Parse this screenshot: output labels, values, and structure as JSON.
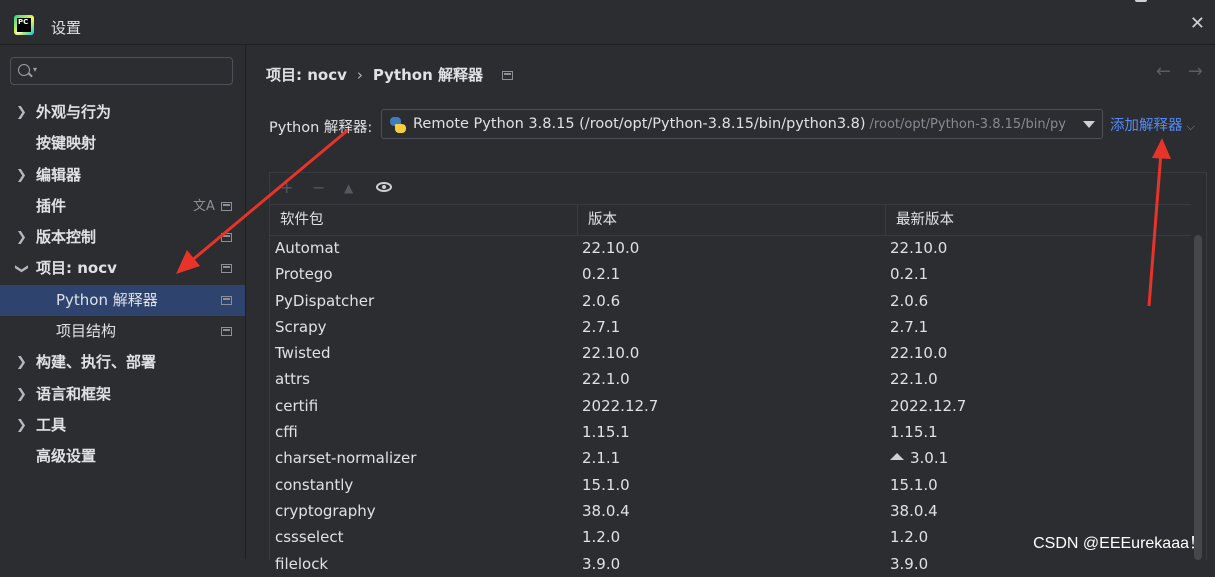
{
  "window": {
    "title": "设置",
    "app_icon_text": "PC"
  },
  "sidebar": {
    "search": {
      "value": "",
      "placeholder": ""
    },
    "items": [
      {
        "label": "外观与行为",
        "chevron": "›"
      },
      {
        "label": "按键映射",
        "chevron": ""
      },
      {
        "label": "编辑器",
        "chevron": "›"
      },
      {
        "label": "插件",
        "chevron": ""
      },
      {
        "label": "版本控制",
        "chevron": "›"
      },
      {
        "label": "项目: nocv",
        "chevron": "⌄"
      },
      {
        "label": "Python 解释器",
        "chevron": ""
      },
      {
        "label": "项目结构",
        "chevron": ""
      },
      {
        "label": "构建、执行、部署",
        "chevron": "›"
      },
      {
        "label": "语言和框架",
        "chevron": "›"
      },
      {
        "label": "工具",
        "chevron": "›"
      },
      {
        "label": "高级设置",
        "chevron": ""
      }
    ]
  },
  "main": {
    "breadcrumb": {
      "project": "项目: nocv",
      "separator": "›",
      "page": "Python 解释器"
    },
    "interpreter_label": "Python 解释器:",
    "interpreter_value": "Remote Python 3.8.15 (/root/opt/Python-3.8.15/bin/python3.8)",
    "interpreter_path": "/root/opt/Python-3.8.15/bin/py",
    "add_interpreter": "添加解释器",
    "toolbar": {
      "add": "+",
      "remove": "−",
      "upgrade": "▲"
    },
    "table": {
      "headers": [
        "软件包",
        "版本",
        "最新版本"
      ],
      "rows": [
        {
          "name": "Automat",
          "version": "22.10.0",
          "latest": "22.10.0",
          "upgrade": false
        },
        {
          "name": "Protego",
          "version": "0.2.1",
          "latest": "0.2.1",
          "upgrade": false
        },
        {
          "name": "PyDispatcher",
          "version": "2.0.6",
          "latest": "2.0.6",
          "upgrade": false
        },
        {
          "name": "Scrapy",
          "version": "2.7.1",
          "latest": "2.7.1",
          "upgrade": false
        },
        {
          "name": "Twisted",
          "version": "22.10.0",
          "latest": "22.10.0",
          "upgrade": false
        },
        {
          "name": "attrs",
          "version": "22.1.0",
          "latest": "22.1.0",
          "upgrade": false
        },
        {
          "name": "certifi",
          "version": "2022.12.7",
          "latest": "2022.12.7",
          "upgrade": false
        },
        {
          "name": "cffi",
          "version": "1.15.1",
          "latest": "1.15.1",
          "upgrade": false
        },
        {
          "name": "charset-normalizer",
          "version": "2.1.1",
          "latest": "3.0.1",
          "upgrade": true
        },
        {
          "name": "constantly",
          "version": "15.1.0",
          "latest": "15.1.0",
          "upgrade": false
        },
        {
          "name": "cryptography",
          "version": "38.0.4",
          "latest": "38.0.4",
          "upgrade": false
        },
        {
          "name": "cssselect",
          "version": "1.2.0",
          "latest": "1.2.0",
          "upgrade": false
        },
        {
          "name": "filelock",
          "version": "3.9.0",
          "latest": "3.9.0",
          "upgrade": false
        }
      ]
    }
  },
  "watermark": "CSDN @EEEurekaaa！",
  "colors": {
    "background": "#2b2d30",
    "selection": "#2e436e",
    "link": "#548af7",
    "annotation_arrow": "#e8332a"
  }
}
